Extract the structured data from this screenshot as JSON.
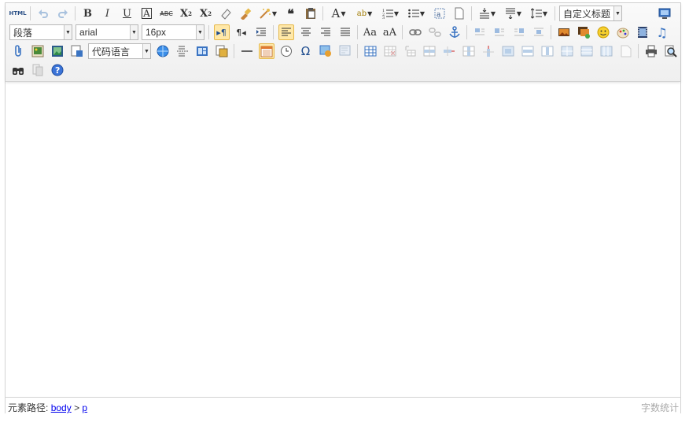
{
  "toolbar": {
    "html_label": "HTML",
    "paragraph_select": "段落",
    "font_family_select": "arial",
    "font_size_select": "16px",
    "code_language_select": "代码语言",
    "custom_title_select": "自定义标题"
  },
  "statusbar": {
    "path_label": "元素路径:",
    "path_body": "body",
    "path_sep": ">",
    "path_p": "p",
    "word_count": "字数统计"
  },
  "content": {
    "text": ""
  }
}
